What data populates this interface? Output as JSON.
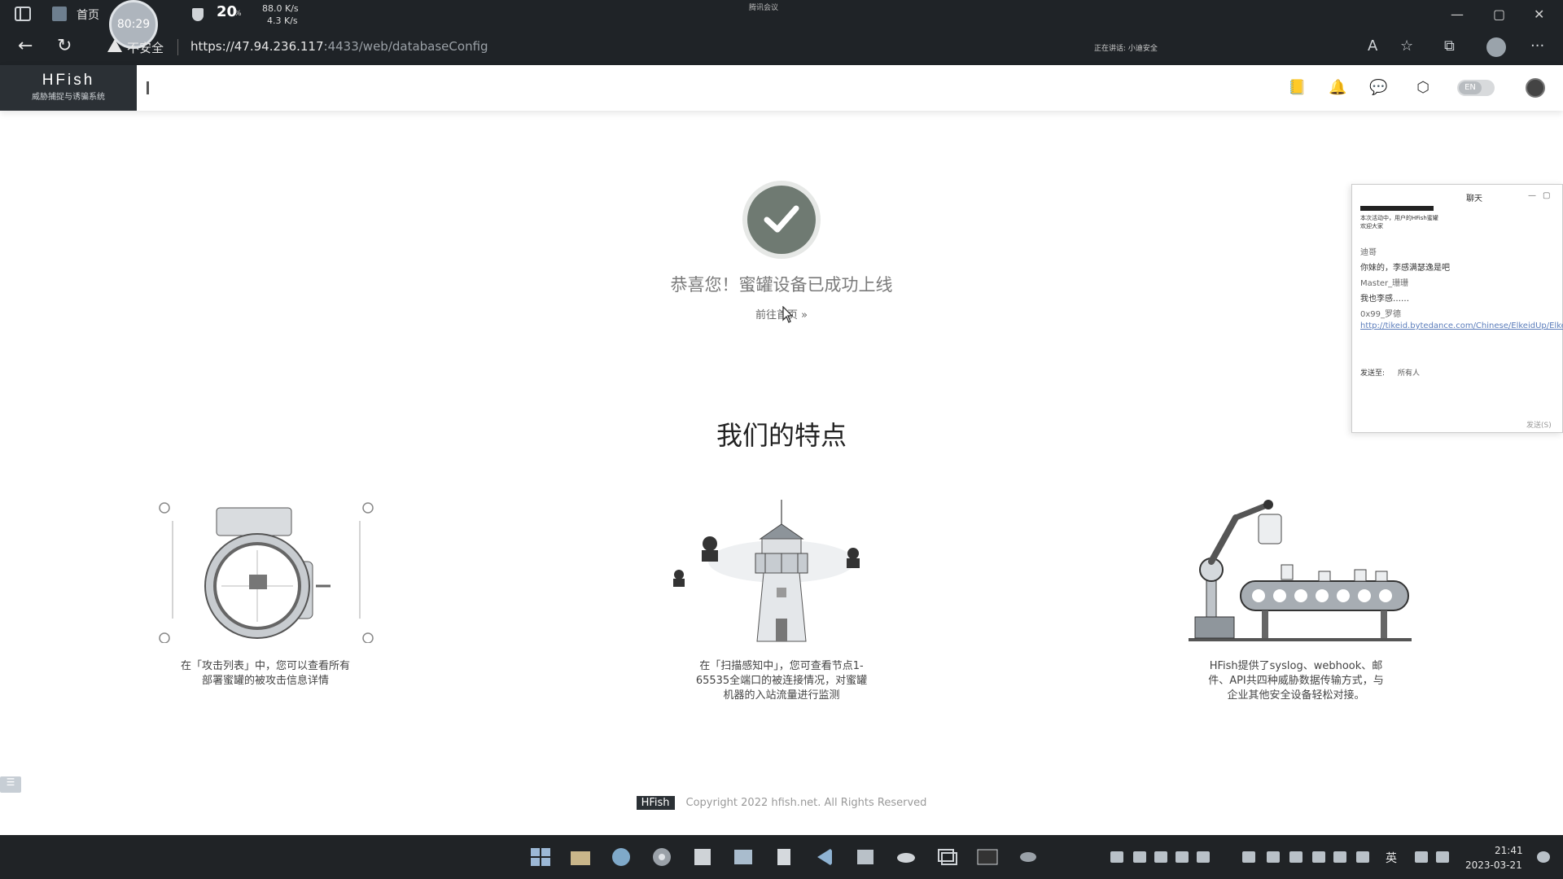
{
  "browser": {
    "tab_title": "首页",
    "timer": "80:29",
    "cpu_value": "20",
    "cpu_unit": "%",
    "net_up": "88.0 K/s",
    "net_down": "4.3 K/s",
    "meeting_title": "腾讯会议",
    "insecure_label": "不安全",
    "url_main": "https://47.94.236.117",
    "url_rest": ":4433/web/databaseConfig",
    "speaking_label": "正在讲话: 小迪安全"
  },
  "app": {
    "logo_main": "HFish",
    "logo_sub": "威胁捕捉与诱骗系统",
    "lang_label": "EN"
  },
  "main": {
    "success_title": "恭喜您！蜜罐设备已成功上线",
    "goto_link": "前往首页 »",
    "features_title": "我们的特点",
    "features": [
      {
        "desc_1": "在「攻击列表」中，您可以查看所有",
        "desc_2": "部署蜜罐的被攻击信息详情",
        "desc_3": ""
      },
      {
        "desc_1": "在「扫描感知中」，您可查看节点1-",
        "desc_2": "65535全端口的被连接情况，对蜜罐",
        "desc_3": "机器的入站流量进行监测"
      },
      {
        "desc_1": "HFish提供了syslog、webhook、邮",
        "desc_2": "件、API共四种威胁数据传输方式，与",
        "desc_3": "企业其他安全设备轻松对接。"
      }
    ],
    "footer_brand": "HFish",
    "footer_copyright": "Copyright 2022 hfish.net. All Rights Reserved"
  },
  "chat": {
    "title": "聊天",
    "preview_line": "本次活动中，用户的HFish蜜罐",
    "preview_line2": "欢迎大家",
    "sender_1": "迪哥",
    "msg_1": "你妹的，李感满瑟逸是吧",
    "sender_2": "Master_珊珊",
    "msg_2": "我也李感……",
    "sender_3": "0x99_罗德",
    "link": "http://tikeid.bytedance.com/Chinese/ElkeidUp/ElkeidUp.html",
    "send_to_label": "发送至:",
    "send_to_value": "所有人",
    "send_button": "发送(S)"
  },
  "taskbar": {
    "lang": "英",
    "time": "21:41",
    "date": "2023-03-21"
  }
}
